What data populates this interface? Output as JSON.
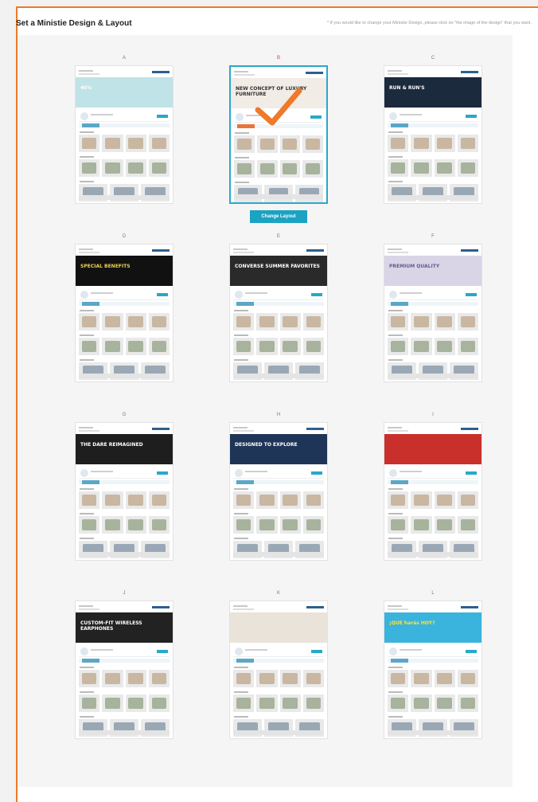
{
  "header": {
    "title": "Set a Ministie Design & Layout",
    "hint": "* If you would like to change your Ministie Design, please click on \"the image of the design\" that you want."
  },
  "change_layout_label": "Change Layout",
  "selected": "B",
  "layouts": [
    {
      "letter": "A",
      "hero_text": "40%",
      "hero_bg": "#bfe3e6",
      "hero_fg": "#ffffff"
    },
    {
      "letter": "B",
      "hero_text": "NEW CONCEPT OF LUXURY FURNITURE",
      "hero_bg": "#f1ece6",
      "hero_fg": "#333333"
    },
    {
      "letter": "C",
      "hero_text": "RUN & RUN'S",
      "hero_bg": "#1b2a3d",
      "hero_fg": "#ffffff"
    },
    {
      "letter": "D",
      "hero_text": "SPECIAL BENEFITS",
      "hero_bg": "#111111",
      "hero_fg": "#f0d24a"
    },
    {
      "letter": "E",
      "hero_text": "CONVERSE SUMMER FAVORITES",
      "hero_bg": "#2a2a2a",
      "hero_fg": "#ffffff"
    },
    {
      "letter": "F",
      "hero_text": "PREMIUM QUALITY",
      "hero_bg": "#d9d4e6",
      "hero_fg": "#6a5a8f"
    },
    {
      "letter": "G",
      "hero_text": "THE DARE REIMAGINED",
      "hero_bg": "#1e1e1e",
      "hero_fg": "#ffffff"
    },
    {
      "letter": "H",
      "hero_text": "DESIGNED TO EXPLORE",
      "hero_bg": "#1f3558",
      "hero_fg": "#ffffff"
    },
    {
      "letter": "I",
      "hero_text": "",
      "hero_bg": "#c9302c",
      "hero_fg": "#ffffff"
    },
    {
      "letter": "J",
      "hero_text": "CUSTOM-FIT WIRELESS EARPHONES",
      "hero_bg": "#222222",
      "hero_fg": "#ffffff"
    },
    {
      "letter": "K",
      "hero_text": "",
      "hero_bg": "#e9e3da",
      "hero_fg": "#333333"
    },
    {
      "letter": "L",
      "hero_text": "¡QUE harás HOY?",
      "hero_bg": "#3ab3dd",
      "hero_fg": "#ffe23a"
    }
  ]
}
